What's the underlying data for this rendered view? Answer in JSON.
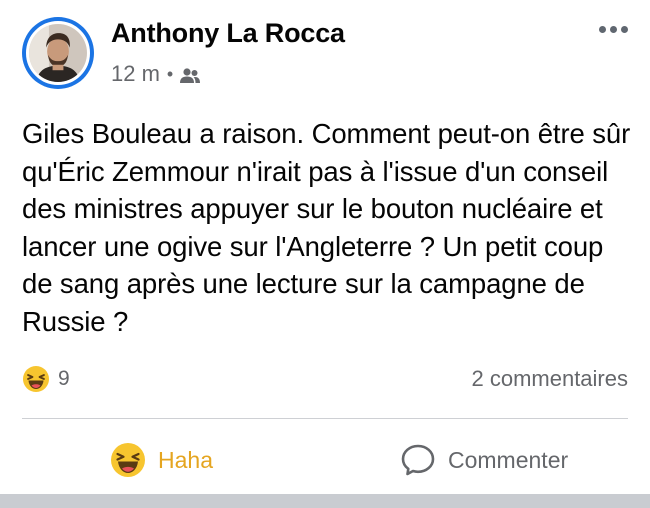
{
  "post": {
    "author": "Anthony La Rocca",
    "time": "12 m",
    "separator": "•",
    "audience_icon": "friends-icon",
    "text": "Giles Bouleau a raison. Comment peut-on être sûr qu'Éric Zemmour n'irait pas à l'issue d'un conseil des ministres appuyer sur le bouton nucléaire et lancer une ogive sur l'Angleterre ? Un petit coup de sang après une lecture sur la campagne de Russie ?",
    "reactions": {
      "icon": "haha-emoji-icon",
      "count": "9"
    },
    "comments_count": "2 commentaires"
  },
  "actions": {
    "haha_label": "Haha",
    "comment_label": "Commenter"
  },
  "colors": {
    "haha_accent": "#e5a520",
    "avatar_ring": "#1b74e4",
    "muted_text": "#65676b"
  }
}
